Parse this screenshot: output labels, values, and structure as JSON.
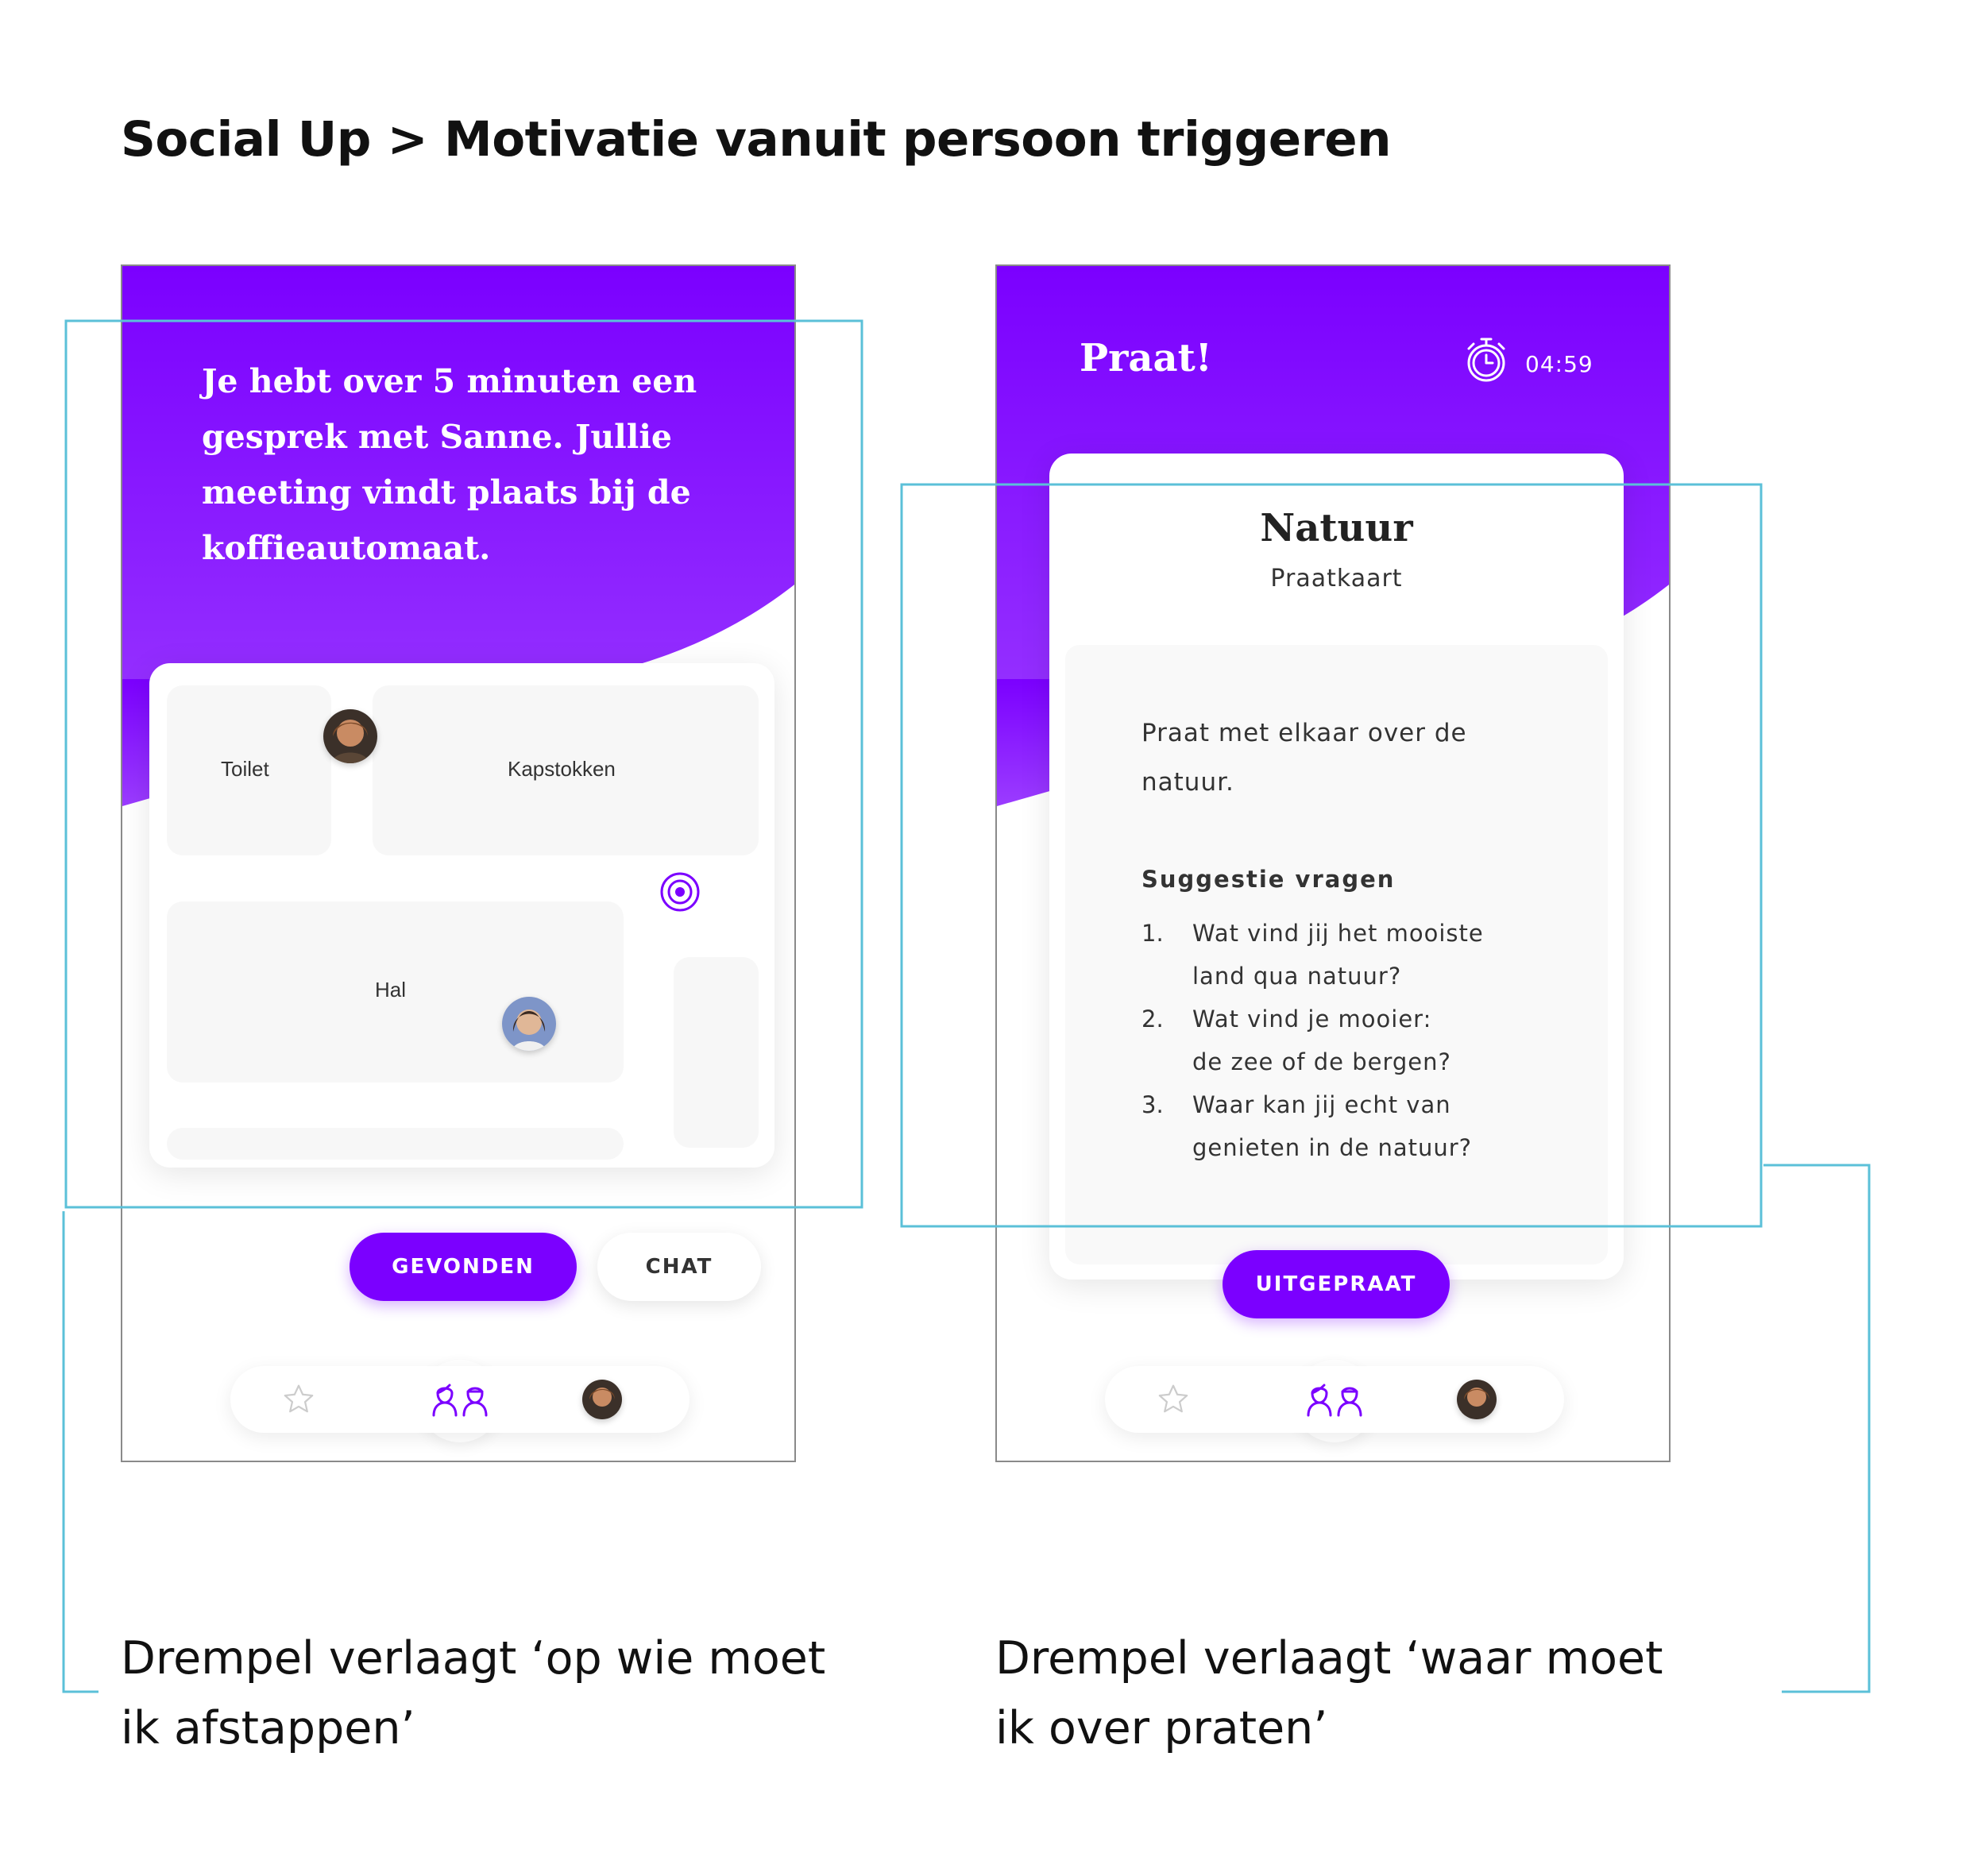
{
  "page": {
    "title": "Social Up > Motivatie vanuit persoon triggeren"
  },
  "colors": {
    "brand_purple": "#7B00FF",
    "highlight_cyan": "#5BC0D8",
    "room_gray": "#F7F7F7"
  },
  "screen_left": {
    "intro_text": "Je hebt over 5 minuten een gesprek met Sanne. Jullie meeting vindt plaats bij de koffieautomaat.",
    "map": {
      "rooms": {
        "toilet": "Toilet",
        "kapstokken": "Kapstokken",
        "hal": "Hal"
      },
      "target_icon": "target-icon"
    },
    "buttons": {
      "found": "GEVONDEN",
      "chat": "CHAT"
    }
  },
  "screen_right": {
    "header": {
      "title": "Praat!",
      "timer_icon": "stopwatch-icon",
      "timer": "04:59"
    },
    "card": {
      "title": "Natuur",
      "subtitle": "Praatkaart",
      "body": "Praat met elkaar over de natuur.",
      "suggestions_heading": "Suggestie vragen",
      "questions": [
        {
          "num": "1.",
          "text": "Wat vind jij het mooiste\nland qua natuur?"
        },
        {
          "num": "2.",
          "text": "Wat vind je mooier:\nde zee of de bergen?"
        },
        {
          "num": "3.",
          "text": "Waar kan jij echt van\ngenieten in de natuur?"
        }
      ]
    },
    "buttons": {
      "done": "UITGEPRAAT"
    }
  },
  "nav": {
    "items": [
      "star-icon",
      "people-icon",
      "avatar-profile"
    ]
  },
  "captions": {
    "left": "Drempel verlaagt ‘op wie moet ik afstappen’",
    "right": "Drempel verlaagt ‘waar moet ik over praten’"
  }
}
